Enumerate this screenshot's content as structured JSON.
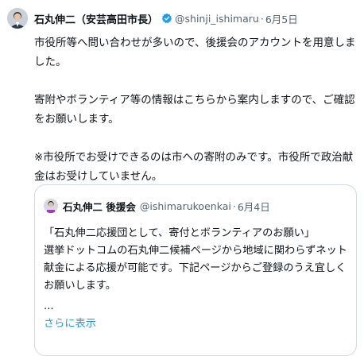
{
  "tweet": {
    "author_name": "石丸伸二（安芸高田市長）",
    "handle": "@shinji_ishimaru",
    "separator": "·",
    "date": "6月5日",
    "paragraphs": [
      "市役所等へ問い合わせが多いので、後援会のアカウントを用意しました。",
      "寄附やボランティア等の情報はこちらから案内しますので、ご確認をお願いします。",
      "※市役所でお受けできるのは市への寄附のみです。市役所で政治献金はお受けしていません。"
    ]
  },
  "quoted": {
    "author_name": "石丸伸二 後援会",
    "handle": "@ishimarukoenkai",
    "separator": "·",
    "date": "6月4日",
    "line1": "「石丸伸二応援団として、寄付とボランティアのお願い」",
    "line2": "選挙ドットコムの石丸伸二候補ページから地域に関わらずネット献金による応援が可能です。下記ページからご登録のうえ宜しくお願いします。",
    "ellipsis": "...",
    "show_more": "さらに表示"
  },
  "colors": {
    "verified": "#1d9bf0",
    "link": "#1d9bf0",
    "muted": "#536471",
    "border": "#cfd9de"
  }
}
